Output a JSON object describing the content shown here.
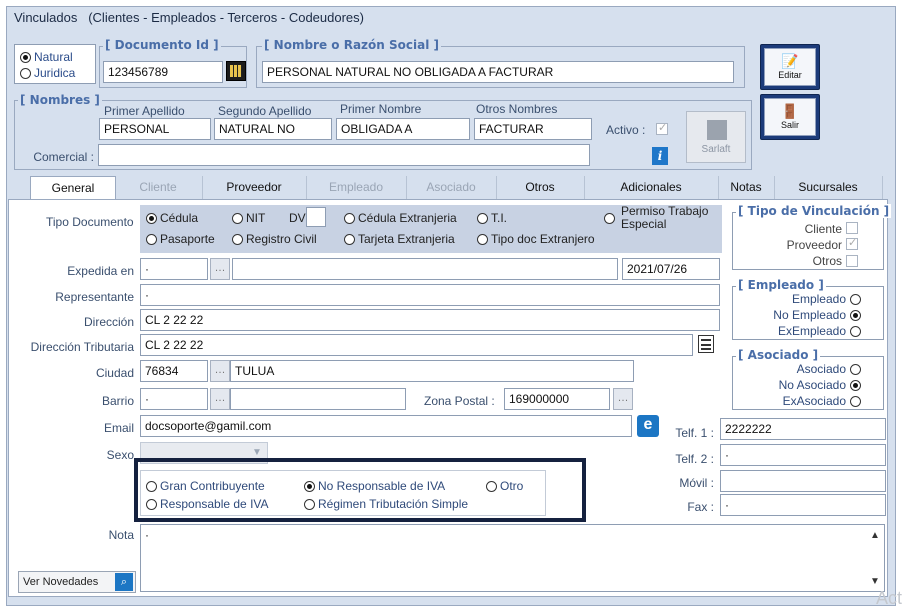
{
  "window": {
    "title": "Vinculados",
    "subtitle": "(Clientes - Empleados - Terceros - Codeudores)"
  },
  "person_type": {
    "natural": "Natural",
    "juridica": "Juridica",
    "selected": "natural"
  },
  "documento": {
    "group_title": "[ Documento Id ]",
    "value": "123456789"
  },
  "razon_social": {
    "group_title": "[ Nombre o Razón Social ]",
    "value": "PERSONAL NATURAL NO OBLIGADA A FACTURAR"
  },
  "buttons": {
    "editar": "Editar",
    "salir": "Salir",
    "sarlaft": "Sarlaft",
    "ver_novedades": "Ver Novedades"
  },
  "nombres": {
    "group_title": "[ Nombres ]",
    "primer_apellido_label": "Primer Apellido",
    "segundo_apellido_label": "Segundo Apellido",
    "primer_nombre_label": "Primer Nombre",
    "otros_nombres_label": "Otros Nombres",
    "primer_apellido": "PERSONAL",
    "segundo_apellido": "NATURAL NO",
    "primer_nombre": "OBLIGADA A",
    "otros_nombres": "FACTURAR",
    "activo_label": "Activo :",
    "comercial_label": "Comercial :",
    "comercial": ""
  },
  "tabs": [
    {
      "label": "General",
      "state": "active"
    },
    {
      "label": "Cliente",
      "state": "disabled"
    },
    {
      "label": "Proveedor",
      "state": "normal"
    },
    {
      "label": "Empleado",
      "state": "disabled"
    },
    {
      "label": "Asociado",
      "state": "disabled"
    },
    {
      "label": "Otros",
      "state": "normal"
    },
    {
      "label": "Adicionales",
      "state": "normal"
    },
    {
      "label": "Notas",
      "state": "normal"
    },
    {
      "label": "Sucursales",
      "state": "normal"
    }
  ],
  "tipo_documento": {
    "label": "Tipo Documento",
    "options": {
      "cedula": "Cédula",
      "nit": "NIT",
      "dv": "DV",
      "cedula_extranjeria": "Cédula Extranjeria",
      "ti": "T.I.",
      "permiso": "Permiso Trabajo",
      "permiso2": "Especial",
      "pasaporte": "Pasaporte",
      "registro_civil": "Registro Civil",
      "tarjeta_extranjeria": "Tarjeta Extranjeria",
      "tipo_doc_extranjero": "Tipo doc Extranjero"
    },
    "selected": "cedula"
  },
  "form": {
    "expedida_label": "Expedida en",
    "expedida_code": "·",
    "expedida_date": "2021/07/26",
    "representante_label": "Representante",
    "representante": "·",
    "direccion_label": "Dirección",
    "direccion": "CL 2 22 22",
    "direccion_trib_label": "Dirección Tributaria",
    "direccion_trib": "CL 2 22 22",
    "ciudad_label": "Ciudad",
    "ciudad_code": "76834",
    "ciudad_name": "TULUA",
    "barrio_label": "Barrio",
    "barrio": "·",
    "zona_label": "Zona Postal :",
    "zona": "169000000",
    "email_label": "Email",
    "email": "docsoporte@gamil.com",
    "sexo_label": "Sexo",
    "nota_label": "Nota",
    "nota": "·",
    "telf1_label": "Telf. 1 :",
    "telf1": "2222222",
    "telf2_label": "Telf. 2 :",
    "telf2": "·",
    "movil_label": "Móvil :",
    "movil": "",
    "fax_label": "Fax :",
    "fax": "·"
  },
  "iva": {
    "gran": "Gran Contribuyente",
    "no_resp": "No Responsable de IVA",
    "otro": "Otro",
    "resp": "Responsable de IVA",
    "simple": "Régimen Tributación Simple",
    "selected": "no_resp"
  },
  "vinculacion": {
    "title": "[ Tipo de Vinculación ]",
    "cliente": "Cliente",
    "proveedor": "Proveedor",
    "otros": "Otros"
  },
  "empleado": {
    "title": "[ Empleado ]",
    "empleado": "Empleado",
    "no_empleado": "No Empleado",
    "ex_empleado": "ExEmpleado"
  },
  "asociado": {
    "title": "[ Asociado ]",
    "asociado": "Asociado",
    "no_asociado": "No Asociado",
    "ex_asociado": "ExAsociado"
  },
  "watermark": "Act",
  "colors": {
    "accent": "#1c3b7a",
    "panel": "#d6e0ee",
    "label": "#3a4f6e"
  }
}
